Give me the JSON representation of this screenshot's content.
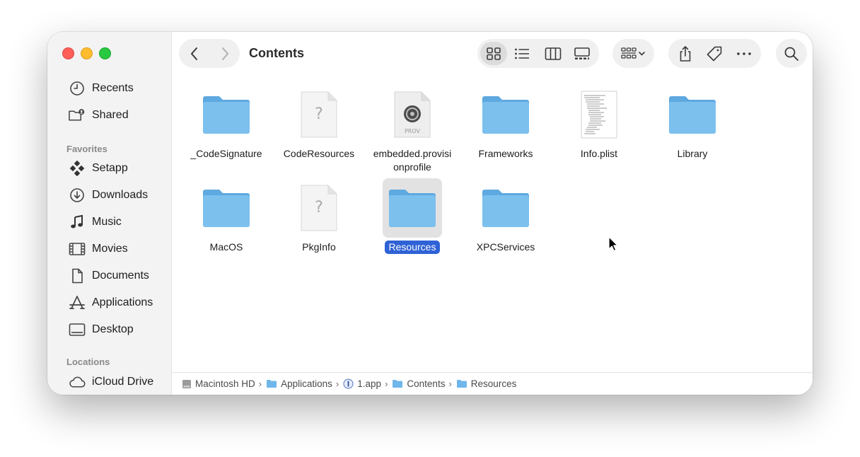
{
  "window": {
    "title": "Contents"
  },
  "sidebar": {
    "top_items": [
      {
        "label": "Recents",
        "icon": "clock-icon"
      },
      {
        "label": "Shared",
        "icon": "shared-folder-icon"
      }
    ],
    "favorites_heading": "Favorites",
    "favorites": [
      {
        "label": "Setapp",
        "icon": "setapp-icon"
      },
      {
        "label": "Downloads",
        "icon": "download-icon"
      },
      {
        "label": "Music",
        "icon": "music-note-icon"
      },
      {
        "label": "Movies",
        "icon": "film-icon"
      },
      {
        "label": "Documents",
        "icon": "document-icon"
      },
      {
        "label": "Applications",
        "icon": "applications-icon"
      },
      {
        "label": "Desktop",
        "icon": "desktop-icon"
      }
    ],
    "locations_heading": "Locations",
    "locations": [
      {
        "label": "iCloud Drive",
        "icon": "cloud-icon"
      }
    ]
  },
  "toolbar": {
    "back": "chevron-left-icon",
    "forward": "chevron-right-icon",
    "views": [
      "icon-view-icon",
      "list-view-icon",
      "column-view-icon",
      "gallery-view-icon"
    ],
    "active_view": "icon-view-icon",
    "group": "group-icon",
    "share": "share-icon",
    "tag": "tag-icon",
    "more": "more-icon",
    "search": "search-icon"
  },
  "files": [
    {
      "name": "_CodeSignature",
      "kind": "folder"
    },
    {
      "name": "CodeResources",
      "kind": "unknown-file"
    },
    {
      "name": "embedded.provisi\nonprofile",
      "kind": "provisioning-profile",
      "badge": "PROV"
    },
    {
      "name": "Frameworks",
      "kind": "folder"
    },
    {
      "name": "Info.plist",
      "kind": "plist-file"
    },
    {
      "name": "Library",
      "kind": "folder"
    },
    {
      "name": "MacOS",
      "kind": "folder"
    },
    {
      "name": "PkgInfo",
      "kind": "unknown-file"
    },
    {
      "name": "Resources",
      "kind": "folder",
      "selected": true
    },
    {
      "name": "XPCServices",
      "kind": "folder"
    }
  ],
  "pathbar": [
    {
      "label": "Macintosh HD",
      "icon": "disk-icon"
    },
    {
      "label": "Applications",
      "icon": "folder-icon"
    },
    {
      "label": "1.app",
      "icon": "app-icon"
    },
    {
      "label": "Contents",
      "icon": "folder-icon"
    },
    {
      "label": "Resources",
      "icon": "folder-icon"
    }
  ],
  "colors": {
    "accent": "#2f62d6",
    "folder": "#7cc0ee",
    "sidebar_bg": "#f3f3f3"
  }
}
